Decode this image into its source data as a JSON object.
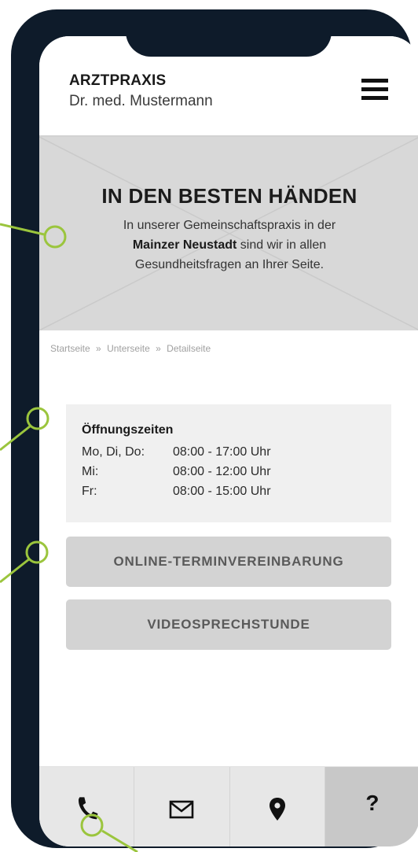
{
  "header": {
    "brand": "ARZTPRAXIS",
    "doctor": "Dr. med. Mustermann",
    "menu_icon": "hamburger-menu-icon"
  },
  "hero": {
    "title": "IN DEN BESTEN HÄNDEN",
    "text_before": "In unserer Gemeinschaftspraxis in der",
    "text_bold": "Mainzer Neustadt",
    "text_after": "sind wir in allen Gesundheitsfragen an Ihrer Seite."
  },
  "breadcrumb": {
    "items": [
      "Startseite",
      "Unterseite",
      "Detailseite"
    ],
    "separator": "»"
  },
  "hours": {
    "title": "Öffnungszeiten",
    "rows": [
      {
        "days": "Mo, Di, Do:",
        "time": "08:00 - 17:00 Uhr"
      },
      {
        "days": "Mi:",
        "time": "08:00 - 12:00 Uhr"
      },
      {
        "days": "Fr:",
        "time": "08:00 - 15:00 Uhr"
      }
    ]
  },
  "buttons": {
    "appointment": "ONLINE-TERMINVEREINBARUNG",
    "video": "VIDEOSPRECHSTUNDE"
  },
  "tabbar": {
    "items": [
      {
        "icon": "phone-icon"
      },
      {
        "icon": "mail-icon"
      },
      {
        "icon": "location-pin-icon"
      },
      {
        "icon": "help-icon",
        "label": "?"
      }
    ]
  },
  "colors": {
    "frame": "#0e1b2a",
    "accent": "#9bc53d",
    "placeholder": "#d8d8d8",
    "button": "#d3d3d3"
  }
}
